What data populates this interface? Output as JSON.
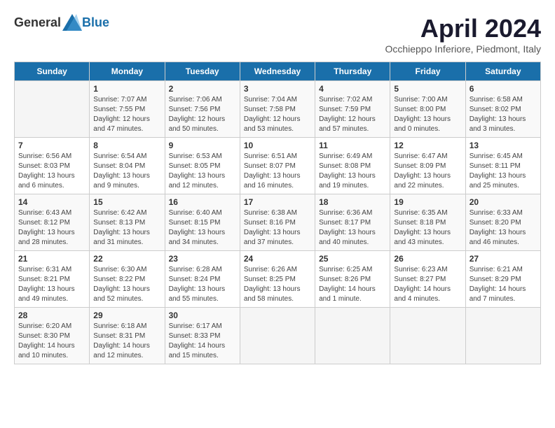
{
  "header": {
    "logo_general": "General",
    "logo_blue": "Blue",
    "month_title": "April 2024",
    "location": "Occhieppo Inferiore, Piedmont, Italy"
  },
  "days_of_week": [
    "Sunday",
    "Monday",
    "Tuesday",
    "Wednesday",
    "Thursday",
    "Friday",
    "Saturday"
  ],
  "weeks": [
    [
      {
        "day": "",
        "empty": true
      },
      {
        "day": "1",
        "sunrise": "Sunrise: 7:07 AM",
        "sunset": "Sunset: 7:55 PM",
        "daylight": "Daylight: 12 hours and 47 minutes."
      },
      {
        "day": "2",
        "sunrise": "Sunrise: 7:06 AM",
        "sunset": "Sunset: 7:56 PM",
        "daylight": "Daylight: 12 hours and 50 minutes."
      },
      {
        "day": "3",
        "sunrise": "Sunrise: 7:04 AM",
        "sunset": "Sunset: 7:58 PM",
        "daylight": "Daylight: 12 hours and 53 minutes."
      },
      {
        "day": "4",
        "sunrise": "Sunrise: 7:02 AM",
        "sunset": "Sunset: 7:59 PM",
        "daylight": "Daylight: 12 hours and 57 minutes."
      },
      {
        "day": "5",
        "sunrise": "Sunrise: 7:00 AM",
        "sunset": "Sunset: 8:00 PM",
        "daylight": "Daylight: 13 hours and 0 minutes."
      },
      {
        "day": "6",
        "sunrise": "Sunrise: 6:58 AM",
        "sunset": "Sunset: 8:02 PM",
        "daylight": "Daylight: 13 hours and 3 minutes."
      }
    ],
    [
      {
        "day": "7",
        "sunrise": "Sunrise: 6:56 AM",
        "sunset": "Sunset: 8:03 PM",
        "daylight": "Daylight: 13 hours and 6 minutes."
      },
      {
        "day": "8",
        "sunrise": "Sunrise: 6:54 AM",
        "sunset": "Sunset: 8:04 PM",
        "daylight": "Daylight: 13 hours and 9 minutes."
      },
      {
        "day": "9",
        "sunrise": "Sunrise: 6:53 AM",
        "sunset": "Sunset: 8:05 PM",
        "daylight": "Daylight: 13 hours and 12 minutes."
      },
      {
        "day": "10",
        "sunrise": "Sunrise: 6:51 AM",
        "sunset": "Sunset: 8:07 PM",
        "daylight": "Daylight: 13 hours and 16 minutes."
      },
      {
        "day": "11",
        "sunrise": "Sunrise: 6:49 AM",
        "sunset": "Sunset: 8:08 PM",
        "daylight": "Daylight: 13 hours and 19 minutes."
      },
      {
        "day": "12",
        "sunrise": "Sunrise: 6:47 AM",
        "sunset": "Sunset: 8:09 PM",
        "daylight": "Daylight: 13 hours and 22 minutes."
      },
      {
        "day": "13",
        "sunrise": "Sunrise: 6:45 AM",
        "sunset": "Sunset: 8:11 PM",
        "daylight": "Daylight: 13 hours and 25 minutes."
      }
    ],
    [
      {
        "day": "14",
        "sunrise": "Sunrise: 6:43 AM",
        "sunset": "Sunset: 8:12 PM",
        "daylight": "Daylight: 13 hours and 28 minutes."
      },
      {
        "day": "15",
        "sunrise": "Sunrise: 6:42 AM",
        "sunset": "Sunset: 8:13 PM",
        "daylight": "Daylight: 13 hours and 31 minutes."
      },
      {
        "day": "16",
        "sunrise": "Sunrise: 6:40 AM",
        "sunset": "Sunset: 8:15 PM",
        "daylight": "Daylight: 13 hours and 34 minutes."
      },
      {
        "day": "17",
        "sunrise": "Sunrise: 6:38 AM",
        "sunset": "Sunset: 8:16 PM",
        "daylight": "Daylight: 13 hours and 37 minutes."
      },
      {
        "day": "18",
        "sunrise": "Sunrise: 6:36 AM",
        "sunset": "Sunset: 8:17 PM",
        "daylight": "Daylight: 13 hours and 40 minutes."
      },
      {
        "day": "19",
        "sunrise": "Sunrise: 6:35 AM",
        "sunset": "Sunset: 8:18 PM",
        "daylight": "Daylight: 13 hours and 43 minutes."
      },
      {
        "day": "20",
        "sunrise": "Sunrise: 6:33 AM",
        "sunset": "Sunset: 8:20 PM",
        "daylight": "Daylight: 13 hours and 46 minutes."
      }
    ],
    [
      {
        "day": "21",
        "sunrise": "Sunrise: 6:31 AM",
        "sunset": "Sunset: 8:21 PM",
        "daylight": "Daylight: 13 hours and 49 minutes."
      },
      {
        "day": "22",
        "sunrise": "Sunrise: 6:30 AM",
        "sunset": "Sunset: 8:22 PM",
        "daylight": "Daylight: 13 hours and 52 minutes."
      },
      {
        "day": "23",
        "sunrise": "Sunrise: 6:28 AM",
        "sunset": "Sunset: 8:24 PM",
        "daylight": "Daylight: 13 hours and 55 minutes."
      },
      {
        "day": "24",
        "sunrise": "Sunrise: 6:26 AM",
        "sunset": "Sunset: 8:25 PM",
        "daylight": "Daylight: 13 hours and 58 minutes."
      },
      {
        "day": "25",
        "sunrise": "Sunrise: 6:25 AM",
        "sunset": "Sunset: 8:26 PM",
        "daylight": "Daylight: 14 hours and 1 minute."
      },
      {
        "day": "26",
        "sunrise": "Sunrise: 6:23 AM",
        "sunset": "Sunset: 8:27 PM",
        "daylight": "Daylight: 14 hours and 4 minutes."
      },
      {
        "day": "27",
        "sunrise": "Sunrise: 6:21 AM",
        "sunset": "Sunset: 8:29 PM",
        "daylight": "Daylight: 14 hours and 7 minutes."
      }
    ],
    [
      {
        "day": "28",
        "sunrise": "Sunrise: 6:20 AM",
        "sunset": "Sunset: 8:30 PM",
        "daylight": "Daylight: 14 hours and 10 minutes."
      },
      {
        "day": "29",
        "sunrise": "Sunrise: 6:18 AM",
        "sunset": "Sunset: 8:31 PM",
        "daylight": "Daylight: 14 hours and 12 minutes."
      },
      {
        "day": "30",
        "sunrise": "Sunrise: 6:17 AM",
        "sunset": "Sunset: 8:33 PM",
        "daylight": "Daylight: 14 hours and 15 minutes."
      },
      {
        "day": "",
        "empty": true
      },
      {
        "day": "",
        "empty": true
      },
      {
        "day": "",
        "empty": true
      },
      {
        "day": "",
        "empty": true
      }
    ]
  ]
}
